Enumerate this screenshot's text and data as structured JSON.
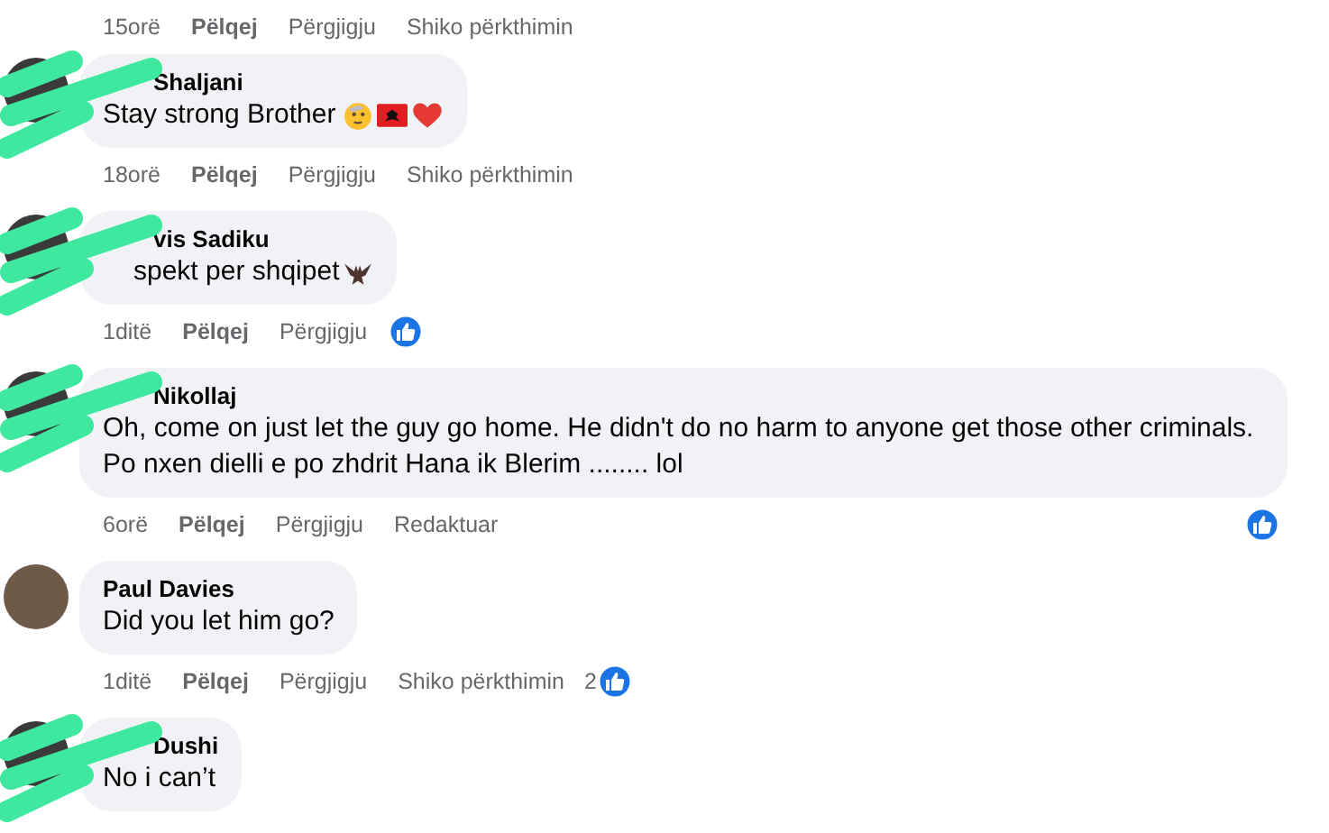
{
  "previous_actions": [
    {
      "kind": "time",
      "label": "15orë"
    },
    {
      "kind": "like",
      "label": "Pëlqej"
    },
    {
      "kind": "reply",
      "label": "Përgjigju"
    },
    {
      "kind": "translate",
      "label": "Shiko përkthimin"
    }
  ],
  "comments": [
    {
      "author": "Shaljani",
      "text": "Stay strong Brother",
      "redacted": true,
      "actions": [
        {
          "kind": "time",
          "label": "18orë"
        },
        {
          "kind": "like",
          "label": "Pëlqej"
        },
        {
          "kind": "reply",
          "label": "Përgjigju"
        },
        {
          "kind": "translate",
          "label": "Shiko përkthimin"
        }
      ]
    },
    {
      "author": "vis Sadiku",
      "text": "spekt per shqipet",
      "redacted": true,
      "actions": [
        {
          "kind": "time",
          "label": "1ditë"
        },
        {
          "kind": "like",
          "label": "Pëlqej"
        },
        {
          "kind": "reply",
          "label": "Përgjigju"
        }
      ],
      "reactions": {
        "kind": "inline"
      }
    },
    {
      "author": "Nikollaj",
      "text": "Oh, come on just let the guy go home. He didn't do no harm to anyone get those other criminals. Po nxen dielli e po zhdrit Hana ik Blerim ........ lol",
      "redacted": true,
      "actions": [
        {
          "kind": "time",
          "label": "6orë"
        },
        {
          "kind": "like",
          "label": "Pëlqej"
        },
        {
          "kind": "reply",
          "label": "Përgjigju"
        },
        {
          "kind": "edited",
          "label": "Redaktuar"
        }
      ],
      "reactions": {
        "kind": "right"
      }
    },
    {
      "author": "Paul Davies",
      "text": "Did you let him go?",
      "redacted": false,
      "actions": [
        {
          "kind": "time",
          "label": "1ditë"
        },
        {
          "kind": "like",
          "label": "Pëlqej"
        },
        {
          "kind": "reply",
          "label": "Përgjigju"
        },
        {
          "kind": "translate",
          "label": "Shiko përkthimin"
        }
      ],
      "reactions": {
        "kind": "inline",
        "count": "2"
      }
    },
    {
      "author": "Dushi",
      "text": "No i can’t",
      "redacted": true
    }
  ]
}
